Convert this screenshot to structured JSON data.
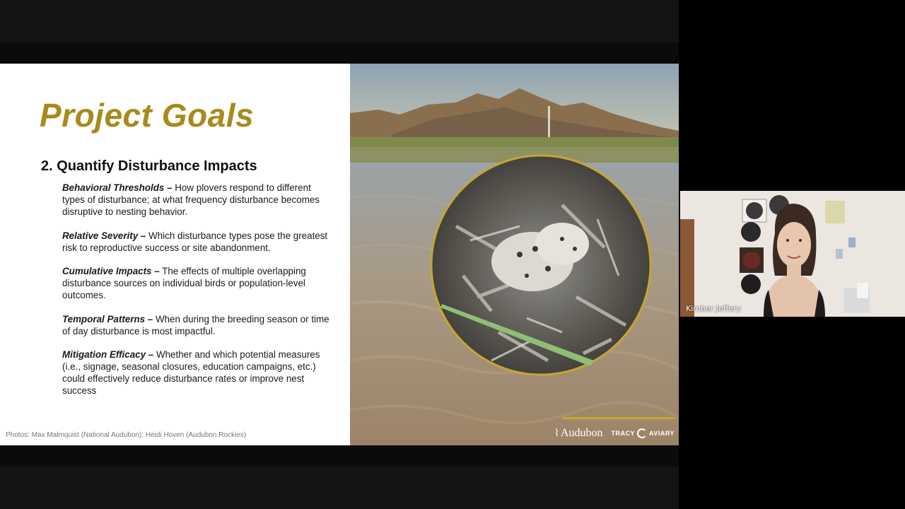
{
  "slide": {
    "title": "Project Goals",
    "subheading": "2. Quantify Disturbance Impacts",
    "goals": [
      {
        "term": "Behavioral Thresholds –",
        "text": " How plovers respond to different types of disturbance; at what frequency disturbance becomes disruptive to nesting behavior."
      },
      {
        "term": "Relative Severity –",
        "text": " Which disturbance types pose the greatest risk to reproductive success or site abandonment."
      },
      {
        "term": "Cumulative Impacts –",
        "text": " The effects of multiple overlapping disturbance sources on individual birds or population-level outcomes."
      },
      {
        "term": "Temporal Patterns –",
        "text": " When during the breeding season or time of day disturbance is most impactful."
      },
      {
        "term": "Mitigation Efficacy –",
        "text": " Whether and which potential measures (i.e., signage, seasonal closures, education campaigns, etc.) could effectively reduce disturbance rates or improve nest success"
      }
    ],
    "credit": "Photos: Max Malmquist (National Audubon); Heidi Hoven (Audubon Rockies)",
    "logos": {
      "audubon": "Audubon",
      "tracy_left": "TRACY",
      "tracy_right": "AVIARY"
    }
  },
  "participant": {
    "name": "Kimber Jeffery"
  },
  "colors": {
    "title_gold": "#a88a1c",
    "logo_line": "#c9a628"
  }
}
